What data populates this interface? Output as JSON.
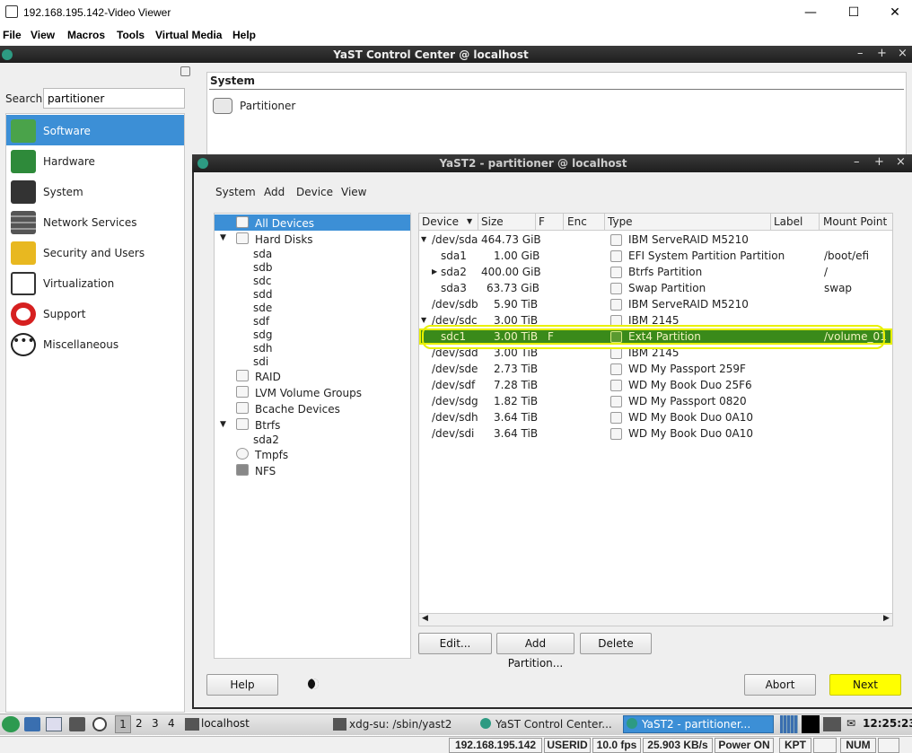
{
  "viewer": {
    "title": "192.168.195.142-Video Viewer",
    "menu": [
      "File",
      "View",
      "Macros",
      "Tools",
      "Virtual Media",
      "Help"
    ]
  },
  "cc": {
    "title": "YaST Control Center @ localhost",
    "search_label": "Search",
    "search_value": "partitioner",
    "categories": [
      {
        "label": "Software",
        "icon": "software-icon"
      },
      {
        "label": "Hardware",
        "icon": "hardware-icon"
      },
      {
        "label": "System",
        "icon": "system-icon"
      },
      {
        "label": "Network Services",
        "icon": "network-icon"
      },
      {
        "label": "Security and Users",
        "icon": "lock-icon"
      },
      {
        "label": "Virtualization",
        "icon": "virtualization-icon"
      },
      {
        "label": "Support",
        "icon": "lifebuoy-icon"
      },
      {
        "label": "Miscellaneous",
        "icon": "more-icon"
      }
    ],
    "group_title": "System",
    "module_label": "Partitioner"
  },
  "partitioner": {
    "title": "YaST2 - partitioner @ localhost",
    "menu": [
      "System",
      "Add",
      "Device",
      "View"
    ],
    "tree": {
      "all_devices": "All Devices",
      "hard_disks": "Hard Disks",
      "disks": [
        "sda",
        "sdb",
        "sdc",
        "sdd",
        "sde",
        "sdf",
        "sdg",
        "sdh",
        "sdi"
      ],
      "raid": "RAID",
      "lvm": "LVM Volume Groups",
      "bcache": "Bcache Devices",
      "btrfs": "Btrfs",
      "btrfs_child": "sda2",
      "tmpfs": "Tmpfs",
      "nfs": "NFS"
    },
    "columns": [
      "Device",
      "Size",
      "F",
      "Enc",
      "Type",
      "Label",
      "Mount Point"
    ],
    "rows": [
      {
        "device": "/dev/sda",
        "size": "464.73 GiB",
        "f": "",
        "type": "IBM ServeRAID M5210",
        "mount": ""
      },
      {
        "device": "sda1",
        "size": "1.00 GiB",
        "f": "",
        "type": "EFI System Partition Partition",
        "mount": "/boot/efi"
      },
      {
        "device": "sda2",
        "size": "400.00 GiB",
        "f": "",
        "type": "Btrfs Partition",
        "mount": "/"
      },
      {
        "device": "sda3",
        "size": "63.73 GiB",
        "f": "",
        "type": "Swap Partition",
        "mount": "swap"
      },
      {
        "device": "/dev/sdb",
        "size": "5.90 TiB",
        "f": "",
        "type": "IBM ServeRAID M5210",
        "mount": ""
      },
      {
        "device": "/dev/sdc",
        "size": "3.00 TiB",
        "f": "",
        "type": "IBM 2145",
        "mount": ""
      },
      {
        "device": "sdc1",
        "size": "3.00 TiB",
        "f": "F",
        "type": "Ext4 Partition",
        "mount": "/volume_01"
      },
      {
        "device": "/dev/sdd",
        "size": "3.00 TiB",
        "f": "",
        "type": "IBM 2145",
        "mount": ""
      },
      {
        "device": "/dev/sde",
        "size": "2.73 TiB",
        "f": "",
        "type": "WD My Passport 259F",
        "mount": ""
      },
      {
        "device": "/dev/sdf",
        "size": "7.28 TiB",
        "f": "",
        "type": "WD My Book Duo 25F6",
        "mount": ""
      },
      {
        "device": "/dev/sdg",
        "size": "1.82 TiB",
        "f": "",
        "type": "WD My Passport 0820",
        "mount": ""
      },
      {
        "device": "/dev/sdh",
        "size": "3.64 TiB",
        "f": "",
        "type": "WD My Book Duo 0A10",
        "mount": ""
      },
      {
        "device": "/dev/sdi",
        "size": "3.64 TiB",
        "f": "",
        "type": "WD My Book Duo 0A10",
        "mount": ""
      }
    ],
    "buttons": {
      "edit": "Edit...",
      "add_partition": "Add Partition...",
      "delete": "Delete",
      "help": "Help",
      "abort": "Abort",
      "next": "Next"
    }
  },
  "taskbar": {
    "workspaces": [
      "1",
      "2",
      "3",
      "4"
    ],
    "host": "localhost",
    "tasks": [
      "xdg-su: /sbin/yast2",
      "YaST Control Center...",
      "YaST2 - partitioner..."
    ],
    "clock": "12:25:23"
  },
  "status": {
    "ip": "192.168.195.142",
    "user": "USERID",
    "fps": "10.0 fps",
    "rate": "25.903 KB/s",
    "power": "Power ON",
    "kpt": "KPT",
    "num": "NUM"
  },
  "colors": {
    "selection": "#3c8fd6",
    "highlight_row": "#3a8a1a",
    "yellow": "#ffff00"
  }
}
